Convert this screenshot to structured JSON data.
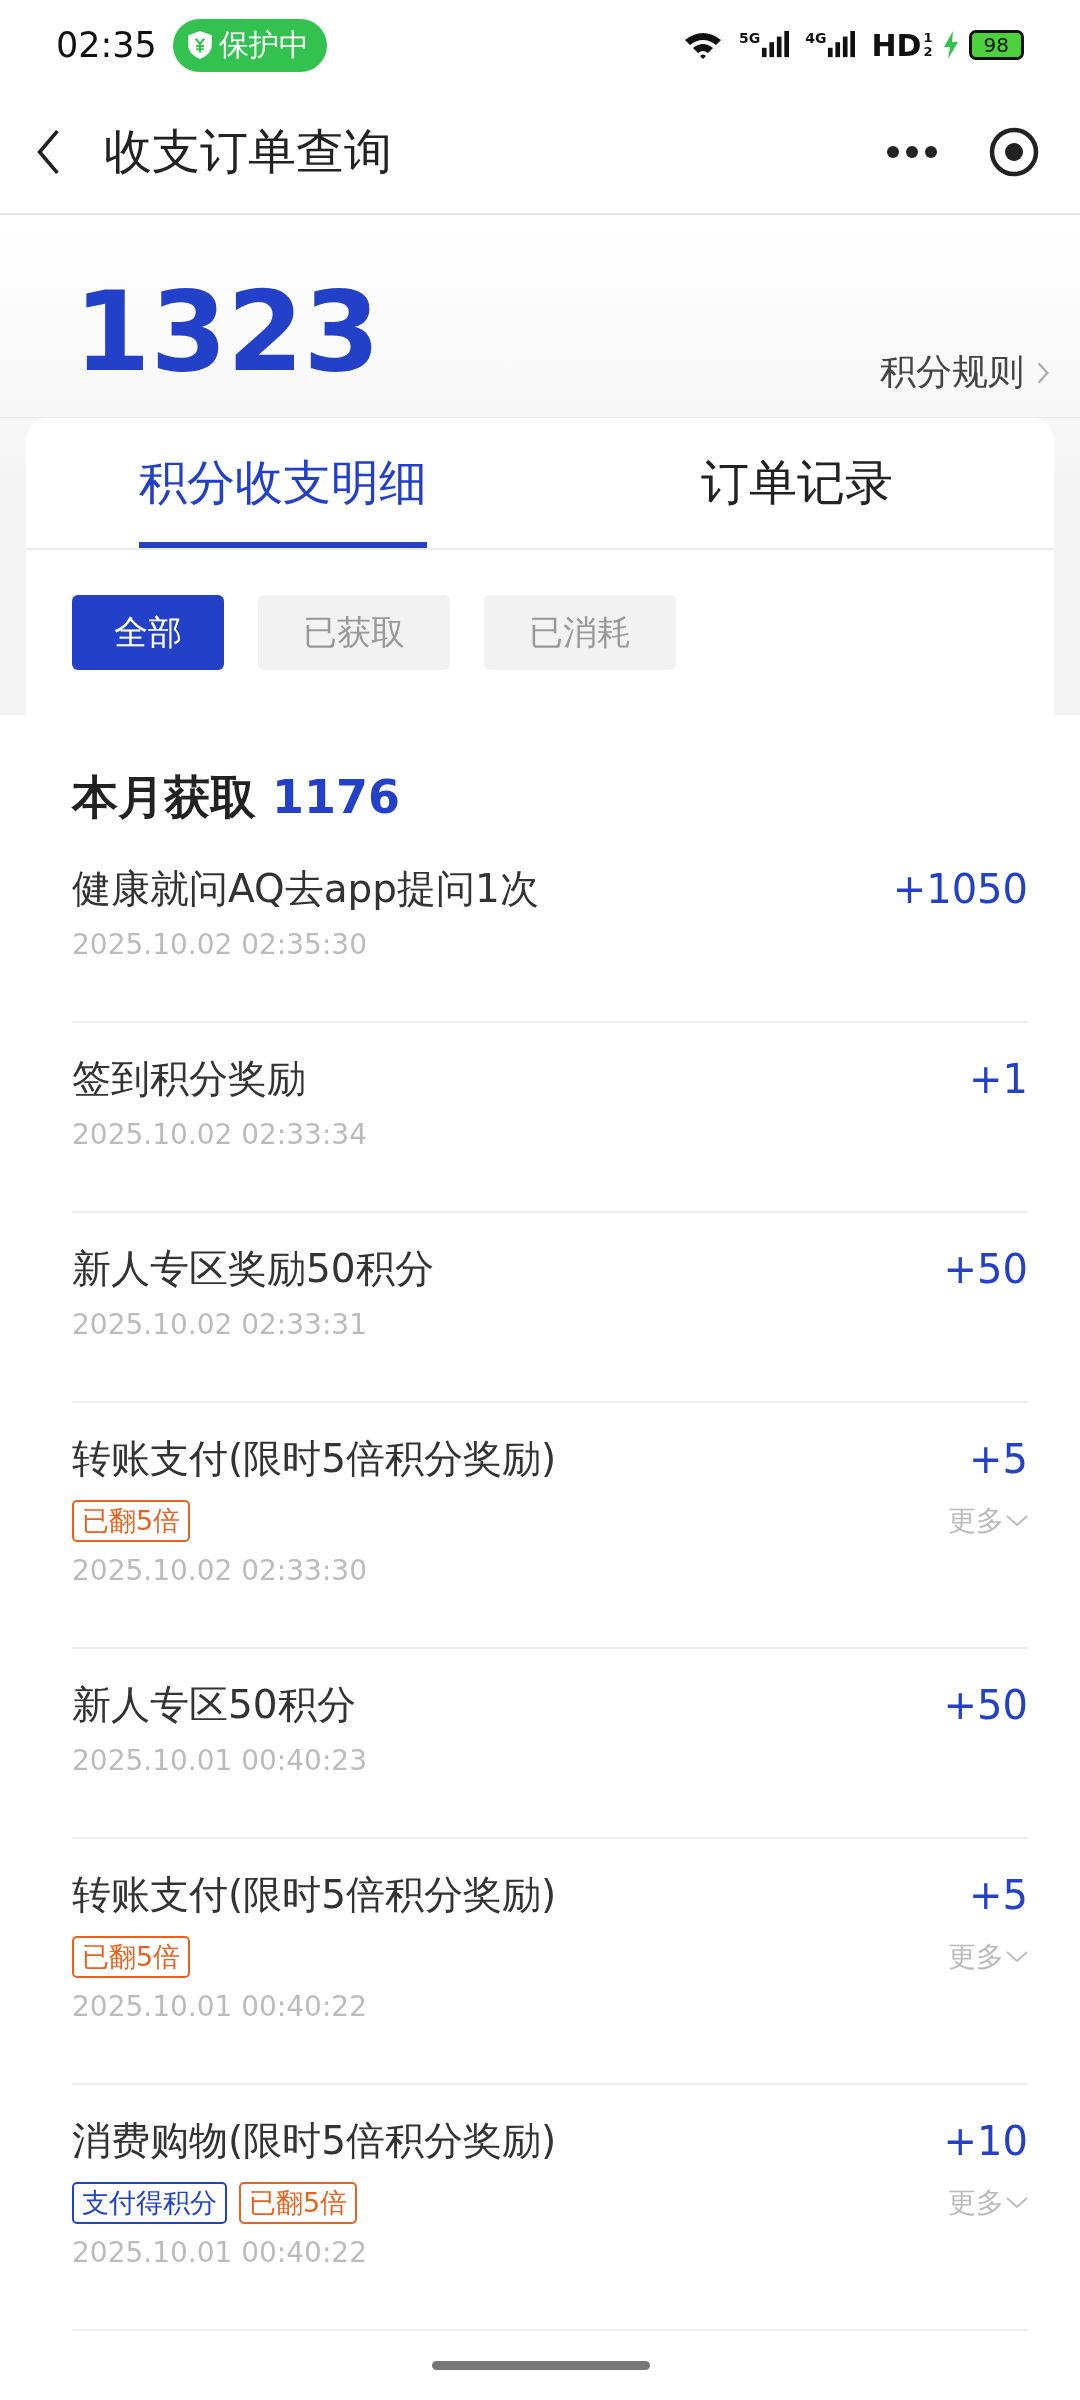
{
  "status_bar": {
    "time": "02:35",
    "badge": "保护中",
    "networks": [
      "5G",
      "4G"
    ],
    "hd": "HD",
    "hd_sub": [
      "1",
      "2"
    ],
    "battery": "98"
  },
  "nav": {
    "title": "收支订单查询"
  },
  "summary": {
    "points": "1323",
    "rules_link": "积分规则"
  },
  "tabs": [
    {
      "label": "积分收支明细",
      "selected": true
    },
    {
      "label": "订单记录",
      "selected": false
    }
  ],
  "filters": [
    {
      "label": "全部",
      "selected": true
    },
    {
      "label": "已获取",
      "selected": false
    },
    {
      "label": "已消耗",
      "selected": false
    }
  ],
  "month": {
    "label": "本月获取",
    "value": "1176"
  },
  "records": [
    {
      "title": "健康就问AQ去app提问1次",
      "amount": "+1050",
      "time": "2025.10.02 02:35:30"
    },
    {
      "title": "签到积分奖励",
      "amount": "+1",
      "time": "2025.10.02 02:33:34"
    },
    {
      "title": "新人专区奖励50积分",
      "amount": "+50",
      "time": "2025.10.02 02:33:31"
    },
    {
      "title": "转账支付(限时5倍积分奖励)",
      "amount": "+5",
      "time": "2025.10.02 02:33:30",
      "tags": [
        {
          "label": "已翻5倍",
          "color": "#e8621f"
        }
      ],
      "more": "更多"
    },
    {
      "title": "新人专区50积分",
      "amount": "+50",
      "time": "2025.10.01 00:40:23"
    },
    {
      "title": "转账支付(限时5倍积分奖励)",
      "amount": "+5",
      "time": "2025.10.01 00:40:22",
      "tags": [
        {
          "label": "已翻5倍",
          "color": "#e8621f"
        }
      ],
      "more": "更多"
    },
    {
      "title": "消费购物(限时5倍积分奖励)",
      "amount": "+10",
      "time": "2025.10.01 00:40:22",
      "tags": [
        {
          "label": "支付得积分",
          "color": "#2242c8"
        },
        {
          "label": "已翻5倍",
          "color": "#e8621f"
        }
      ],
      "more": "更多"
    }
  ]
}
